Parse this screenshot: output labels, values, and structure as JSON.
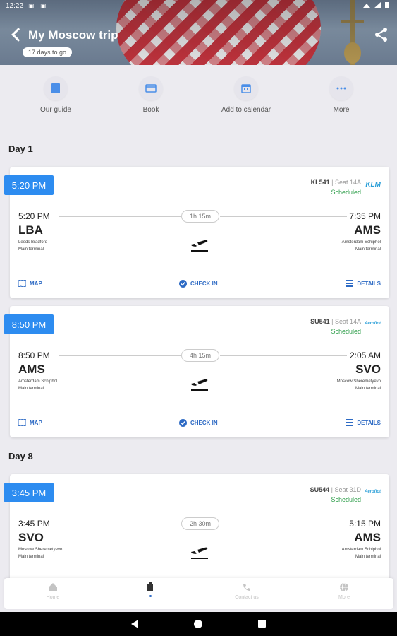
{
  "status_bar": {
    "time": "12:22",
    "notif_icons": "▣ ▣"
  },
  "header": {
    "title": "My Moscow trip",
    "countdown": "17 days to go"
  },
  "actions": [
    {
      "label": "Our guide",
      "icon": "guide-icon"
    },
    {
      "label": "Book",
      "icon": "book-icon"
    },
    {
      "label": "Add to calendar",
      "icon": "calendar-icon"
    },
    {
      "label": "More",
      "icon": "more-icon"
    }
  ],
  "days": [
    {
      "label": "Day 1"
    },
    {
      "label": "Day 8"
    }
  ],
  "flights": [
    {
      "badge_time": "5:20 PM",
      "flight_number": "KL541",
      "seat": "| Seat 14A",
      "status": "Scheduled",
      "airline": "KLM",
      "dep_time": "5:20 PM",
      "dep_code": "LBA",
      "dep_airport": "Leeds Bradford",
      "dep_terminal": "Main terminal",
      "duration": "1h 15m",
      "arr_time": "7:35 PM",
      "arr_code": "AMS",
      "arr_airport": "Amsterdam Schiphol",
      "arr_terminal": "Main terminal",
      "map_label": "MAP",
      "checkin_label": "CHECK IN",
      "details_label": "DETAILS"
    },
    {
      "badge_time": "8:50 PM",
      "flight_number": "SU541",
      "seat": "| Seat 14A",
      "status": "Scheduled",
      "airline": "Aeroflot",
      "dep_time": "8:50 PM",
      "dep_code": "AMS",
      "dep_airport": "Amsterdam Schiphol",
      "dep_terminal": "Main terminal",
      "duration": "4h 15m",
      "arr_time": "2:05 AM",
      "arr_code": "SVO",
      "arr_airport": "Moscow Sheremetyevo",
      "arr_terminal": "Main terminal",
      "map_label": "MAP",
      "checkin_label": "CHECK IN",
      "details_label": "DETAILS"
    },
    {
      "badge_time": "3:45 PM",
      "flight_number": "SU544",
      "seat": "| Seat 31D",
      "status": "Scheduled",
      "airline": "Aeroflot",
      "dep_time": "3:45 PM",
      "dep_code": "SVO",
      "dep_airport": "Moscow Sheremetyevo",
      "dep_terminal": "Main terminal",
      "duration": "2h 30m",
      "arr_time": "5:15 PM",
      "arr_code": "AMS",
      "arr_airport": "Amsterdam Schiphol",
      "arr_terminal": "Main terminal"
    }
  ],
  "bottom_nav": [
    {
      "label": "Home",
      "icon": "home-icon"
    },
    {
      "label": "",
      "icon": "trips-icon",
      "active": true
    },
    {
      "label": "Contact us",
      "icon": "phone-icon"
    },
    {
      "label": "More",
      "icon": "globe-icon"
    }
  ],
  "colors": {
    "accent": "#2d8cf0",
    "link": "#2d6ac4",
    "status_ok": "#2e9e4a",
    "background": "#ecebf0"
  }
}
